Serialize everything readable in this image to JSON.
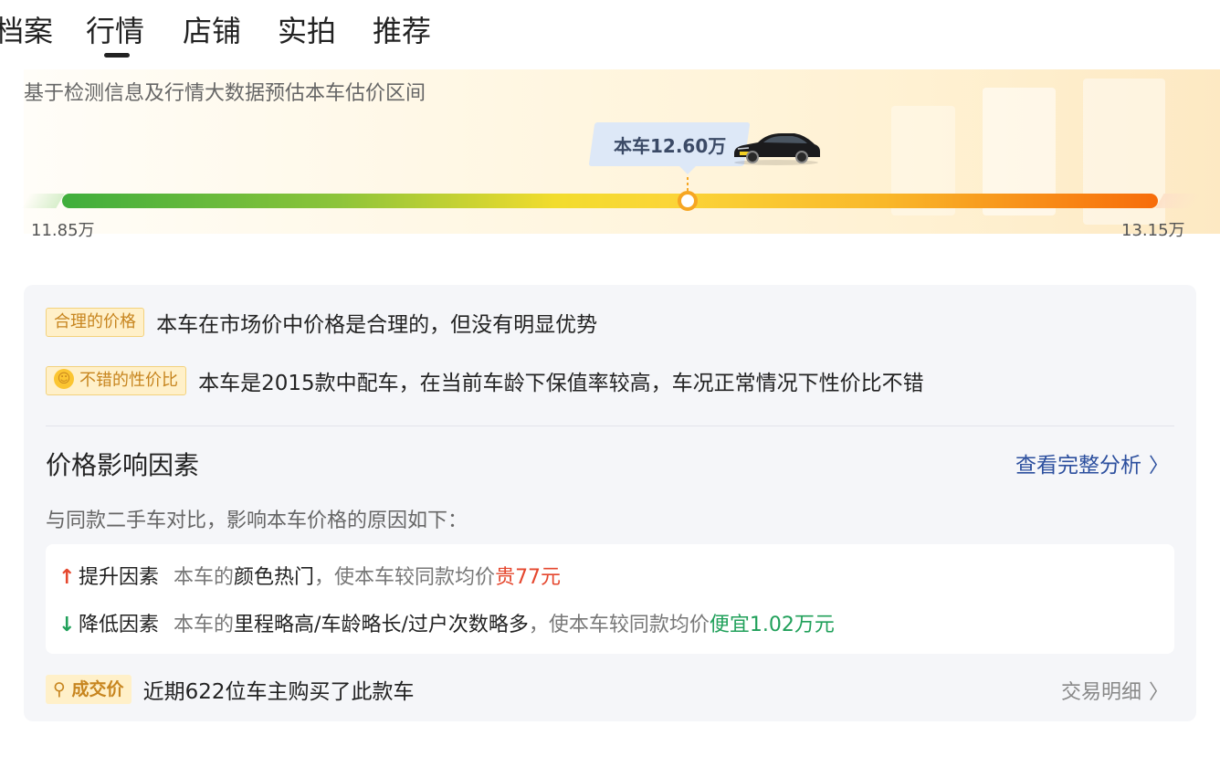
{
  "tabs": [
    {
      "label": "档案"
    },
    {
      "label": "行情"
    },
    {
      "label": "店铺"
    },
    {
      "label": "实拍"
    },
    {
      "label": "推荐"
    }
  ],
  "active_tab": "行情",
  "estimate": {
    "description": "基于检测信息及行情大数据预估本车估价区间",
    "car_price_label": "本车12.60万",
    "min_label": "11.85万",
    "max_label": "13.15万",
    "position_fraction": 0.57
  },
  "assessments": [
    {
      "badge": "合理的价格",
      "text": "本车在市场价中价格是合理的，但没有明显优势",
      "icon": ""
    },
    {
      "badge": "不错的性价比",
      "text": "本车是2015款中配车，在当前车龄下保值率较高，车况正常情况下性价比不错",
      "icon": "smile-icon"
    }
  ],
  "factors_section": {
    "title": "价格影响因素",
    "link_label": "查看完整分析",
    "description": "与同款二手车对比，影响本车价格的原因如下：",
    "factors": [
      {
        "direction": "up",
        "label": "提升因素",
        "prefix": "本车的",
        "key": "颜色热门",
        "middle": "，使本车较同款均价",
        "result": "贵77元"
      },
      {
        "direction": "down",
        "label": "降低因素",
        "prefix": "本车的",
        "key": "里程略高/车龄略长/过户次数略多",
        "middle": "，使本车较同款均价",
        "result": "便宜1.02万元"
      }
    ]
  },
  "deal": {
    "badge": "成交价",
    "text": "近期622位车主购买了此款车",
    "link_label": "交易明细"
  },
  "colors": {
    "up": "#e5472e",
    "down": "#20a05a",
    "link": "#2c4f9e",
    "badge_bg": "#fff0c9",
    "badge_text": "#c7851f"
  }
}
